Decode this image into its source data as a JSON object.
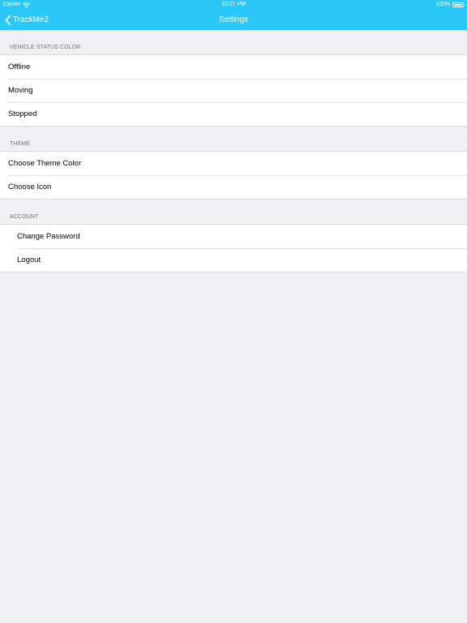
{
  "status_bar": {
    "carrier": "Carrier",
    "time": "10:21 PM",
    "battery": "100%",
    "icons": [
      "wifi-icon",
      "battery-icon"
    ]
  },
  "nav": {
    "back_label": "TrackMe2",
    "back_icon": "chevron-left-icon",
    "title": "Settings",
    "color": "#29c8f9"
  },
  "sections": {
    "vehicle_status": {
      "header": "VEHICLE STATUS COLOR",
      "items": [
        "Offline",
        "Moving",
        "Stopped"
      ]
    },
    "theme": {
      "header": "THEME",
      "items": [
        "Choose Theme Color",
        "Choose Icon"
      ]
    },
    "account": {
      "header": "ACCOUNT",
      "items": [
        "Change Password",
        "Logout"
      ]
    }
  }
}
